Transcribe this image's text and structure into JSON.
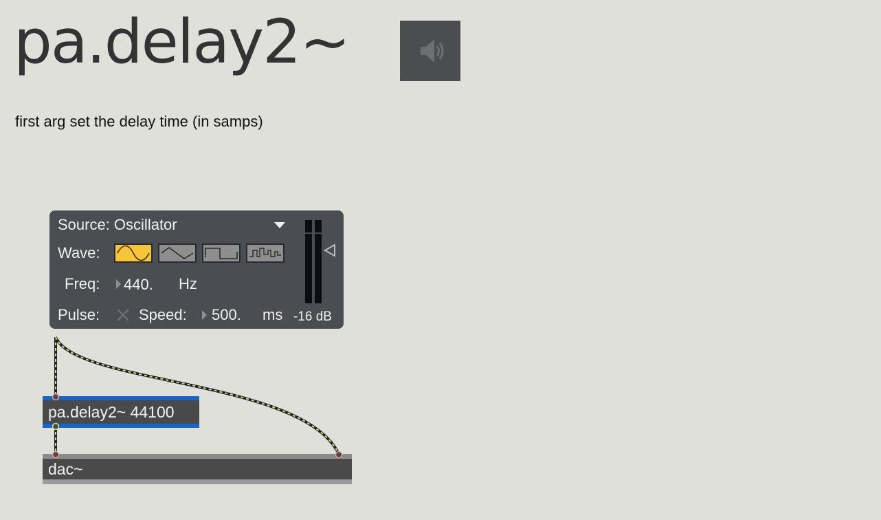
{
  "page": {
    "title": "pa.delay2~",
    "description": "first arg set the delay time (in samps)"
  },
  "speaker": {
    "icon": "speaker-icon"
  },
  "ezdac": {
    "source_label": "Source: Oscillator",
    "wave_label": "Wave:",
    "waves": [
      "sine",
      "triangle",
      "square",
      "random"
    ],
    "selected_wave": "sine",
    "freq_label": "Freq:",
    "freq_value": "440.",
    "freq_unit": "Hz",
    "pulse_label": "Pulse:",
    "speed_label": "Speed:",
    "speed_value": "500.",
    "speed_unit": "ms",
    "meter_readout": "-16 dB"
  },
  "objects": {
    "delay": "pa.delay2~ 44100",
    "dac": "dac~"
  },
  "colors": {
    "background": "#e0e0da",
    "panel": "#4a4d52",
    "selected_wave": "#f7c53a",
    "selection": "#1766c6",
    "patch_cord": "#c9e28a"
  }
}
